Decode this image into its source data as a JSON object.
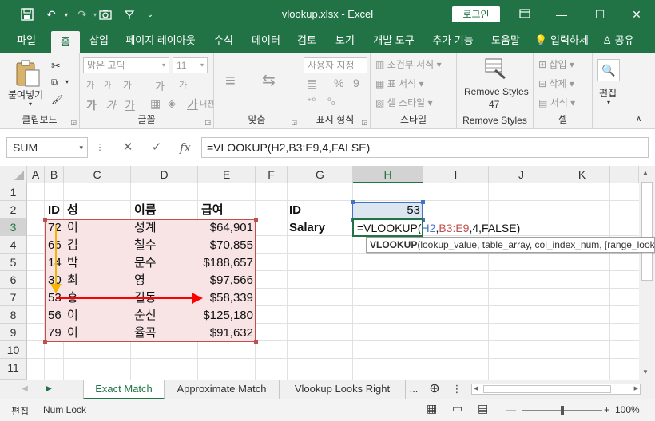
{
  "titlebar": {
    "filename": "vlookup.xlsx",
    "separator": "-",
    "app": "Excel",
    "login_label": "로그인"
  },
  "tabs": [
    "파일",
    "홈",
    "삽입",
    "페이지 레이아웃",
    "수식",
    "데이터",
    "검토",
    "보기",
    "개발 도구",
    "추가 기능",
    "도움말"
  ],
  "active_tab": "홈",
  "tell_me": "입력하세",
  "share": "공유",
  "ribbon": {
    "clipboard": {
      "paste": "붙여넣기",
      "label": "클립보드"
    },
    "font": {
      "name": "맑은 고딕",
      "size": "11",
      "grow": "가",
      "shrink": "가",
      "bold": "가",
      "italic": "가",
      "underline": "가",
      "phonetic": "내천",
      "color_a": "가",
      "label": "글꼴"
    },
    "alignment": {
      "label": "맞춤"
    },
    "number": {
      "format": "사용자 지정",
      "percent": "%",
      "comma": "9",
      "label": "표시 형식"
    },
    "styles": {
      "conditional": "조건부 서식",
      "table": "표 서식",
      "cell": "셀 스타일",
      "label": "스타일"
    },
    "remove_styles": {
      "button": "Remove Styles",
      "count": "47",
      "label": "Remove Styles"
    },
    "cells": {
      "insert": "삽입",
      "delete": "삭제",
      "format": "서식",
      "label": "셀"
    },
    "editing": {
      "label": "편집"
    }
  },
  "formula_bar": {
    "name_box": "SUM",
    "cancel": "✕",
    "enter": "✓",
    "fx": "fx",
    "formula": "=VLOOKUP(H2,B3:E9,4,FALSE)"
  },
  "columns": [
    "A",
    "B",
    "C",
    "D",
    "E",
    "F",
    "G",
    "H",
    "I",
    "J",
    "K"
  ],
  "rows": [
    "1",
    "2",
    "3",
    "4",
    "5",
    "6",
    "7",
    "8",
    "9",
    "10",
    "11"
  ],
  "table": {
    "headers": [
      "ID",
      "성",
      "이름",
      "급여"
    ],
    "rows": [
      [
        "72",
        "이",
        "성계",
        "$64,901"
      ],
      [
        "66",
        "김",
        "철수",
        "$70,855"
      ],
      [
        "14",
        "박",
        "문수",
        "$188,657"
      ],
      [
        "30",
        "최",
        "영",
        "$97,566"
      ],
      [
        "53",
        "홍",
        "길동",
        "$58,339"
      ],
      [
        "56",
        "이",
        "순신",
        "$125,180"
      ],
      [
        "79",
        "이",
        "율곡",
        "$91,632"
      ]
    ]
  },
  "lookup": {
    "id_label": "ID",
    "id_value": "53",
    "salary_label": "Salary",
    "editing": {
      "pre": "=VLOOKUP(",
      "ref1": "H2",
      "comma1": ",",
      "ref2": "B3:E9",
      "rest": ",4,FALSE)"
    },
    "ref1_color": "#4472c4",
    "ref2_color": "#c0504d"
  },
  "tooltip": {
    "func": "VLOOKUP",
    "args": "(lookup_value, table_array, col_index_num, [range_lookup])"
  },
  "sheets": [
    "Exact Match",
    "Approximate Match",
    "Vlookup Looks Right"
  ],
  "active_sheet": "Exact Match",
  "sheets_more": "...",
  "statusbar": {
    "mode": "편집",
    "numlock": "Num Lock",
    "zoom": "100%"
  },
  "colors": {
    "excel_green": "#217346",
    "highlight_pink": "#f8e3e5",
    "arrow_red": "#ff0000",
    "arrow_yellow": "#f4b400"
  }
}
